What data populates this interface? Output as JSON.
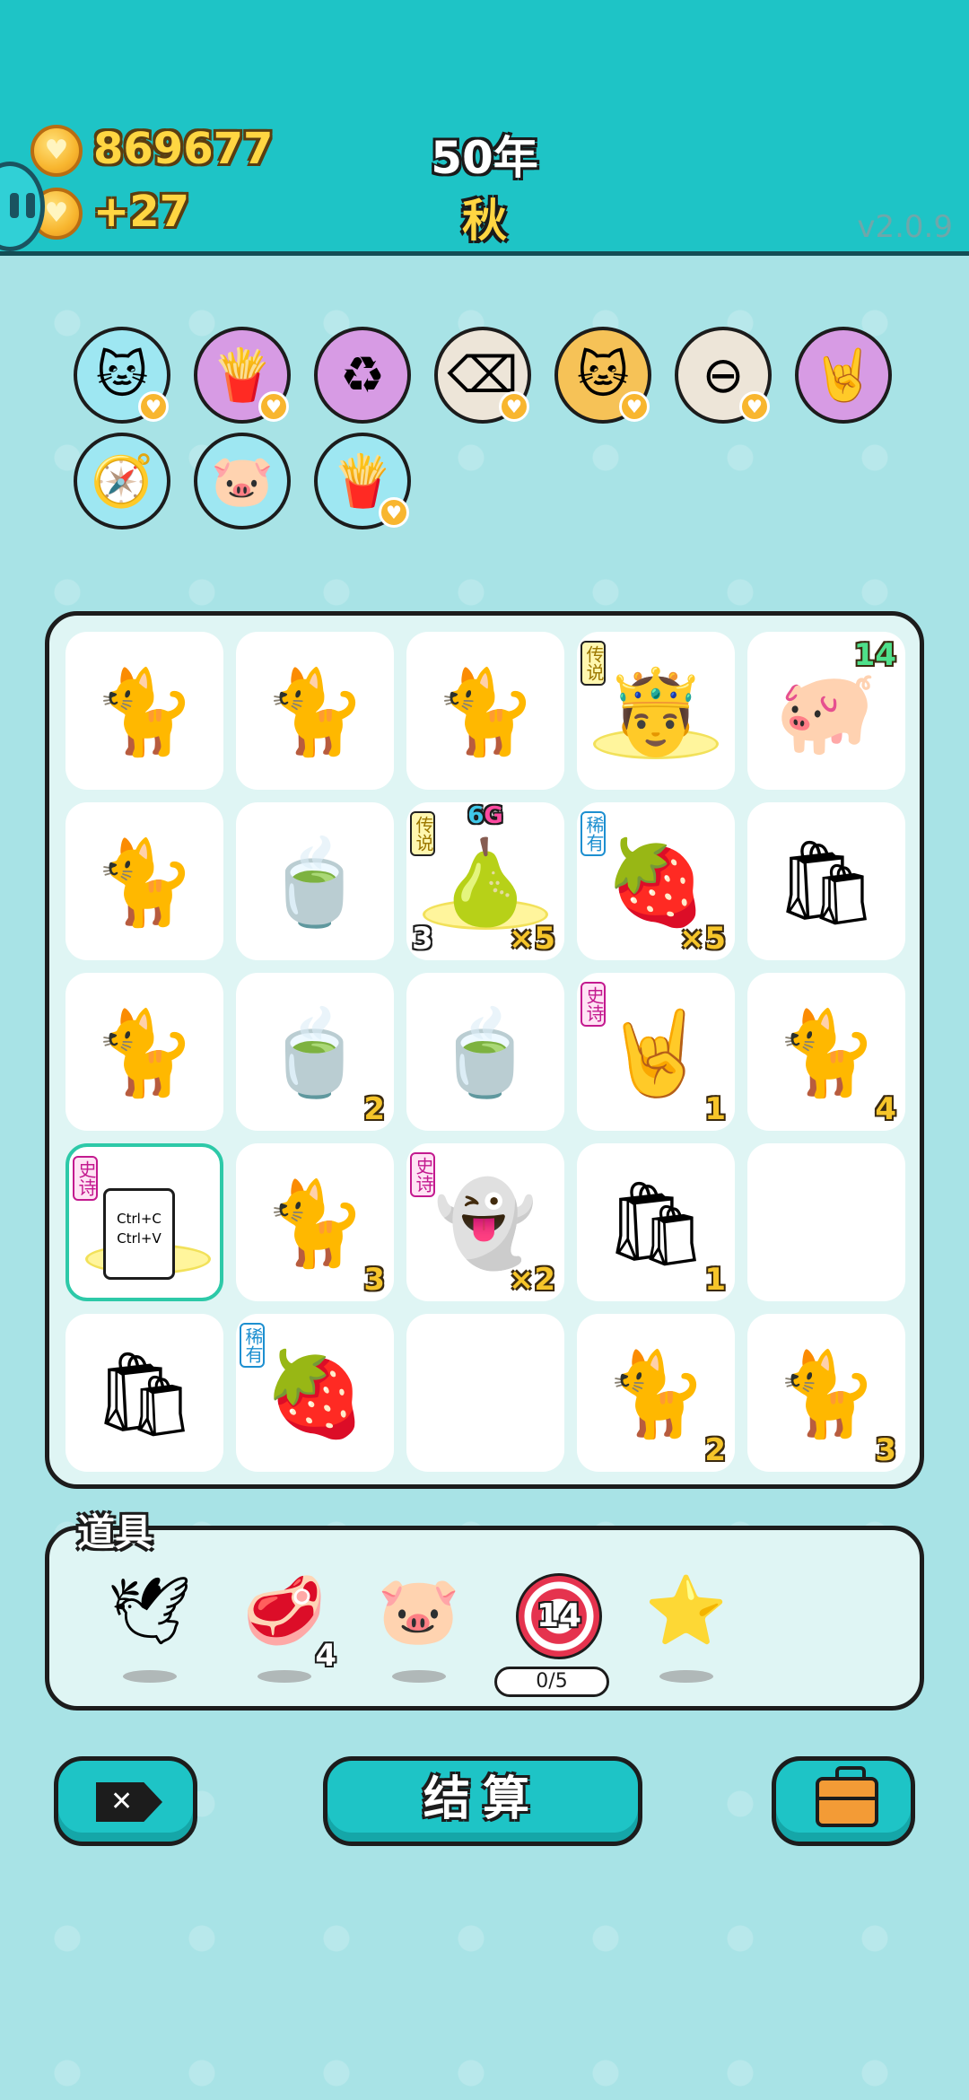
{
  "header": {
    "coins": "869677",
    "gain": "+27",
    "year": "50年",
    "season": "秋",
    "version": "v2.0.9"
  },
  "skills": [
    {
      "icon": "cat-icon",
      "glyph": "🐱",
      "color": "blue",
      "badge": true
    },
    {
      "icon": "fries-icon",
      "glyph": "🍟",
      "color": "purple",
      "badge": true
    },
    {
      "icon": "recycle-icon",
      "glyph": "♻",
      "color": "purple",
      "badge": false
    },
    {
      "icon": "delete-tag-icon",
      "glyph": "⌫",
      "color": "beige",
      "badge": true
    },
    {
      "icon": "cats-icon",
      "glyph": "🐱",
      "color": "orange",
      "badge": true
    },
    {
      "icon": "minus-icon",
      "glyph": "⊖",
      "color": "beige",
      "badge": true
    },
    {
      "icon": "rock-hand-icon",
      "glyph": "🤘",
      "color": "purple",
      "badge": false
    },
    {
      "icon": "compass-icon",
      "glyph": "🧭",
      "color": "blue",
      "badge": false
    },
    {
      "icon": "piggy-bank-icon",
      "glyph": "🐷",
      "color": "blue",
      "badge": false
    },
    {
      "icon": "fries-icon",
      "glyph": "🍟",
      "color": "blue",
      "badge": true
    }
  ],
  "board": [
    {
      "item": "cat",
      "glyph": "🐈",
      "count": ""
    },
    {
      "item": "cat",
      "glyph": "🐈",
      "count": ""
    },
    {
      "item": "cat",
      "glyph": "🐈",
      "count": ""
    },
    {
      "item": "king",
      "glyph": "🤴",
      "tag": "传说",
      "tag_type": "legend",
      "count": ""
    },
    {
      "item": "pig",
      "glyph": "🐖",
      "count": "14",
      "count_style": "green"
    },
    {
      "item": "cat",
      "glyph": "🐈",
      "count": ""
    },
    {
      "item": "tea-bag",
      "glyph": "🍵",
      "count": ""
    },
    {
      "item": "pear",
      "glyph": "🍐",
      "tag": "传说",
      "tag_type": "legend",
      "top_label": "6",
      "top_label2": "G",
      "count": "×5",
      "count_left": "3"
    },
    {
      "item": "lychee",
      "glyph": "🍓",
      "tag": "稀有",
      "tag_type": "rare",
      "count": "×5"
    },
    {
      "item": "trash-bag",
      "glyph": "🛍",
      "count": ""
    },
    {
      "item": "cat",
      "glyph": "🐈",
      "count": ""
    },
    {
      "item": "tea-bag",
      "glyph": "🍵",
      "count": "2"
    },
    {
      "item": "tea-bag",
      "glyph": "🍵",
      "count": ""
    },
    {
      "item": "rock-hand",
      "glyph": "🤘",
      "tag": "史诗",
      "tag_type": "epic",
      "count": "1"
    },
    {
      "item": "cat",
      "glyph": "🐈",
      "count": "4"
    },
    {
      "item": "copy-paste",
      "glyph": "",
      "tag": "史诗",
      "tag_type": "epic",
      "count": "",
      "selected": true,
      "line1": "Ctrl+C",
      "line2": "Ctrl+V"
    },
    {
      "item": "cat",
      "glyph": "🐈",
      "count": "3"
    },
    {
      "item": "ghost",
      "glyph": "👻",
      "tag": "史诗",
      "tag_type": "epic",
      "count": "×2"
    },
    {
      "item": "trash-bag",
      "glyph": "🛍",
      "count": "1"
    },
    {
      "item": "empty",
      "glyph": "",
      "count": ""
    },
    {
      "item": "trash-bag",
      "glyph": "🛍",
      "count": ""
    },
    {
      "item": "lychee",
      "glyph": "🍓",
      "tag": "稀有",
      "tag_type": "rare",
      "count": ""
    },
    {
      "item": "empty",
      "glyph": "",
      "count": ""
    },
    {
      "item": "cat",
      "glyph": "🐈",
      "count": "2"
    },
    {
      "item": "cat",
      "glyph": "🐈",
      "count": "3"
    }
  ],
  "props": {
    "title": "道具",
    "items": [
      {
        "icon": "dove-icon",
        "glyph": "🕊",
        "count": ""
      },
      {
        "icon": "liver-icon",
        "glyph": "🥩",
        "count": "4"
      },
      {
        "icon": "piggy-bank-icon",
        "glyph": "🐷",
        "count": ""
      },
      {
        "icon": "target-icon",
        "glyph": "",
        "count": "",
        "target_value": "14",
        "progress": "0/5"
      },
      {
        "icon": "star-icon",
        "glyph": "⭐",
        "count": ""
      }
    ]
  },
  "buttons": {
    "settle_label": "结算"
  }
}
